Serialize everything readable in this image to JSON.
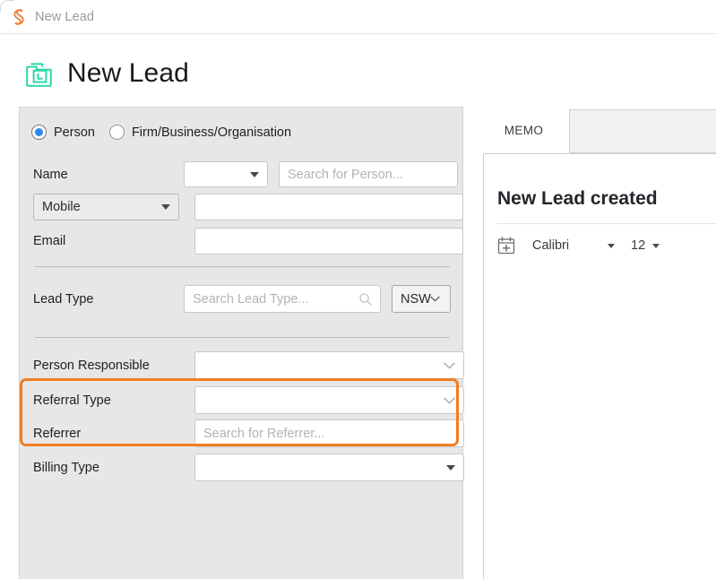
{
  "titlebar": {
    "logo_icon": "spiral-s-logo",
    "title": "New Lead"
  },
  "header": {
    "icon": "lead-folder-icon",
    "title": "New Lead"
  },
  "form": {
    "entity_type": {
      "options": [
        {
          "label": "Person",
          "selected": true
        },
        {
          "label": "Firm/Business/Organisation",
          "selected": false
        }
      ]
    },
    "rows": {
      "name": {
        "label": "Name",
        "title_value": "",
        "search_placeholder": "Search for Person..."
      },
      "phone": {
        "type_value": "Mobile",
        "number_value": ""
      },
      "email": {
        "label": "Email",
        "value": ""
      },
      "lead_type": {
        "label": "Lead Type",
        "placeholder": "Search Lead Type...",
        "search_icon": "magnifier-icon",
        "state_value": "NSW"
      },
      "person_responsible": {
        "label": "Person Responsible",
        "value": ""
      },
      "referral_type": {
        "label": "Referral Type",
        "value": ""
      },
      "referrer": {
        "label": "Referrer",
        "placeholder": "Search for Referrer..."
      },
      "billing_type": {
        "label": "Billing Type",
        "value": ""
      }
    },
    "highlight_color": "#ef7e25"
  },
  "memo": {
    "tabs": [
      {
        "label": "MEMO",
        "active": true
      }
    ],
    "heading": "New Lead created",
    "toolbar": {
      "insert_date_icon": "calendar-plus-icon",
      "font_family": "Calibri",
      "font_size": "12"
    }
  }
}
